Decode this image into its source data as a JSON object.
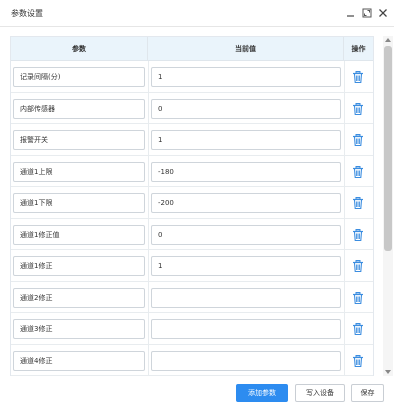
{
  "window": {
    "title": "参数设置"
  },
  "table": {
    "headers": {
      "param": "参数",
      "value": "当前值",
      "operation": "操作"
    },
    "rows": [
      {
        "param": "记录间隔(分)",
        "value": "1"
      },
      {
        "param": "内部传感器",
        "value": "0"
      },
      {
        "param": "报警开关",
        "value": "1"
      },
      {
        "param": "通道1上限",
        "value": "-180"
      },
      {
        "param": "通道1下限",
        "value": "-200"
      },
      {
        "param": "通道1修正值",
        "value": "0"
      },
      {
        "param": "通道1修正",
        "value": "1"
      },
      {
        "param": "通道2修正",
        "value": ""
      },
      {
        "param": "通道3修正",
        "value": ""
      },
      {
        "param": "通道4修正",
        "value": ""
      },
      {
        "param": "",
        "value": ""
      }
    ]
  },
  "footer": {
    "add_label": "添加参数",
    "write_label": "写入设备",
    "save_label": "保存"
  },
  "colors": {
    "primary": "#2d8cf0",
    "header_bg": "#eaf4fb",
    "trash_icon": "#3b8de0"
  },
  "icons": {
    "minimize": "minimize-icon",
    "maximize": "maximize-icon",
    "close": "close-icon",
    "delete": "trash-icon"
  }
}
